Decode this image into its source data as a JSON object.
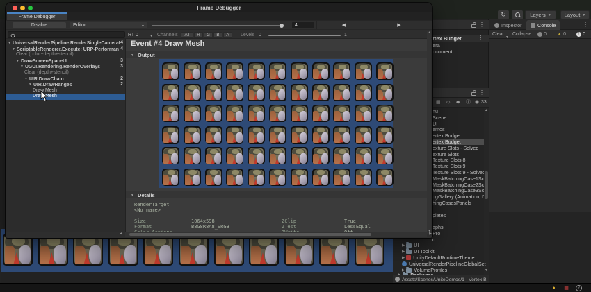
{
  "frame_debugger": {
    "window_title": "Frame Debugger",
    "tab_label": "Frame Debugger",
    "toolbar": {
      "disable_label": "Disable",
      "target_label": "Editor",
      "frame_number": "4"
    },
    "filter_bar": {
      "rt_label": "RT 0",
      "channels_label": "Channels",
      "channel_buttons": [
        "All",
        "R",
        "G",
        "B",
        "A"
      ],
      "levels_label": "Levels",
      "levels_min": "0",
      "levels_max": "1"
    },
    "tree": [
      {
        "label": "UniversalRenderPipeline.RenderSingleCameraI",
        "count": "4",
        "depth": 0,
        "arrow": true,
        "bold": true
      },
      {
        "label": "ScriptableRenderer.Execute: URP-Performan",
        "count": "4",
        "depth": 1,
        "arrow": true,
        "bold": true
      },
      {
        "label": "Clear (color+depth+stencil)",
        "count": "",
        "depth": 2,
        "arrow": false,
        "muted": true
      },
      {
        "label": "DrawScreenSpaceUI",
        "count": "3",
        "depth": 2,
        "arrow": true,
        "bold": true
      },
      {
        "label": "UGUI.Rendering.RenderOverlays",
        "count": "3",
        "depth": 3,
        "arrow": true,
        "bold": true
      },
      {
        "label": "Clear (depth+stencil)",
        "count": "",
        "depth": 4,
        "arrow": false,
        "muted": true
      },
      {
        "label": "UIR.DrawChain",
        "count": "2",
        "depth": 4,
        "arrow": true,
        "bold": true
      },
      {
        "label": "UIR.DrawRanges",
        "count": "2",
        "depth": 5,
        "arrow": true,
        "bold": true
      },
      {
        "label": "Draw Mesh",
        "count": "",
        "depth": 6,
        "arrow": false
      },
      {
        "label": "Draw Mesh",
        "count": "",
        "depth": 6,
        "arrow": false,
        "selected": true
      }
    ],
    "event_title": "Event #4 Draw Mesh",
    "output_section_label": "Output",
    "details_section_label": "Details",
    "details": {
      "render_target_label": "RenderTarget",
      "render_target_name": "<No name>",
      "rows": [
        {
          "k1": "Size",
          "v1": "1064x598",
          "k2": "ZClip",
          "v2": "True"
        },
        {
          "k1": "Format",
          "v1": "B8G8R8A8_SRGB",
          "k2": "ZTest",
          "v2": "LessEqual"
        },
        {
          "k1": "Color Actions",
          "v1": "-",
          "k2": "ZWrite",
          "v2": "Off"
        }
      ]
    },
    "output_grid": {
      "columns": 11,
      "rows": 6
    }
  },
  "editor": {
    "topbar": {
      "layers_label": "Layers",
      "layout_label": "Layout"
    },
    "hierarchy": {
      "scene_label": "rtex Budget",
      "items": [
        "era",
        "ocument"
      ]
    },
    "project": {
      "result_count": "33",
      "list_items": [
        "nu",
        "Scene",
        "UI",
        "emos",
        "ertex Budget",
        "ertex Budget",
        "exture Slots - Solved",
        "exture Slots",
        "Texture Slots 8",
        "Texture Slots 9",
        "Texture Slots 9 - Solved",
        "MaskBatchingCase1Scer",
        "MaskBatchingCase2Sce",
        "MaskBatchingCase3Sce",
        "ogGallery (Animation, D",
        "hingCasesPanels",
        "",
        "plates",
        "",
        "aphs",
        "Pro",
        "o"
      ],
      "selected_index": 5,
      "folder_tree": [
        {
          "label": "UI",
          "arrow": true,
          "icon": "folder"
        },
        {
          "label": "UI Toolkit",
          "arrow": true,
          "icon": "folder"
        },
        {
          "label": "UnityDefaultRuntimeTheme",
          "arrow": true,
          "icon": "theme-asset"
        },
        {
          "label": "UniversalRenderPipelineGlobalSet",
          "arrow": false,
          "icon": "settings-asset"
        },
        {
          "label": "VolumeProfiles",
          "arrow": true,
          "icon": "folder"
        },
        {
          "label": "Packages",
          "arrow": true,
          "icon": "folder",
          "bold": true
        }
      ],
      "breadcrumb": "Assets/Scenes/UniteDemos/1 - Vertex B"
    },
    "console": {
      "inspector_tab": "Inspector",
      "console_tab": "Console",
      "clear_label": "Clear",
      "collapse_label": "Collapse",
      "info_count": "0",
      "warning_count": "0",
      "error_count": "0"
    },
    "gameview": {
      "card_count": 11
    }
  },
  "colors": {
    "accent_orange": "#c87d2a",
    "selection_blue": "#2d5c94",
    "preview_blue": "#2e4a76",
    "tab_accent": "#4a84c4",
    "status_yellow": "#e0b12f",
    "status_red": "#c94040"
  }
}
